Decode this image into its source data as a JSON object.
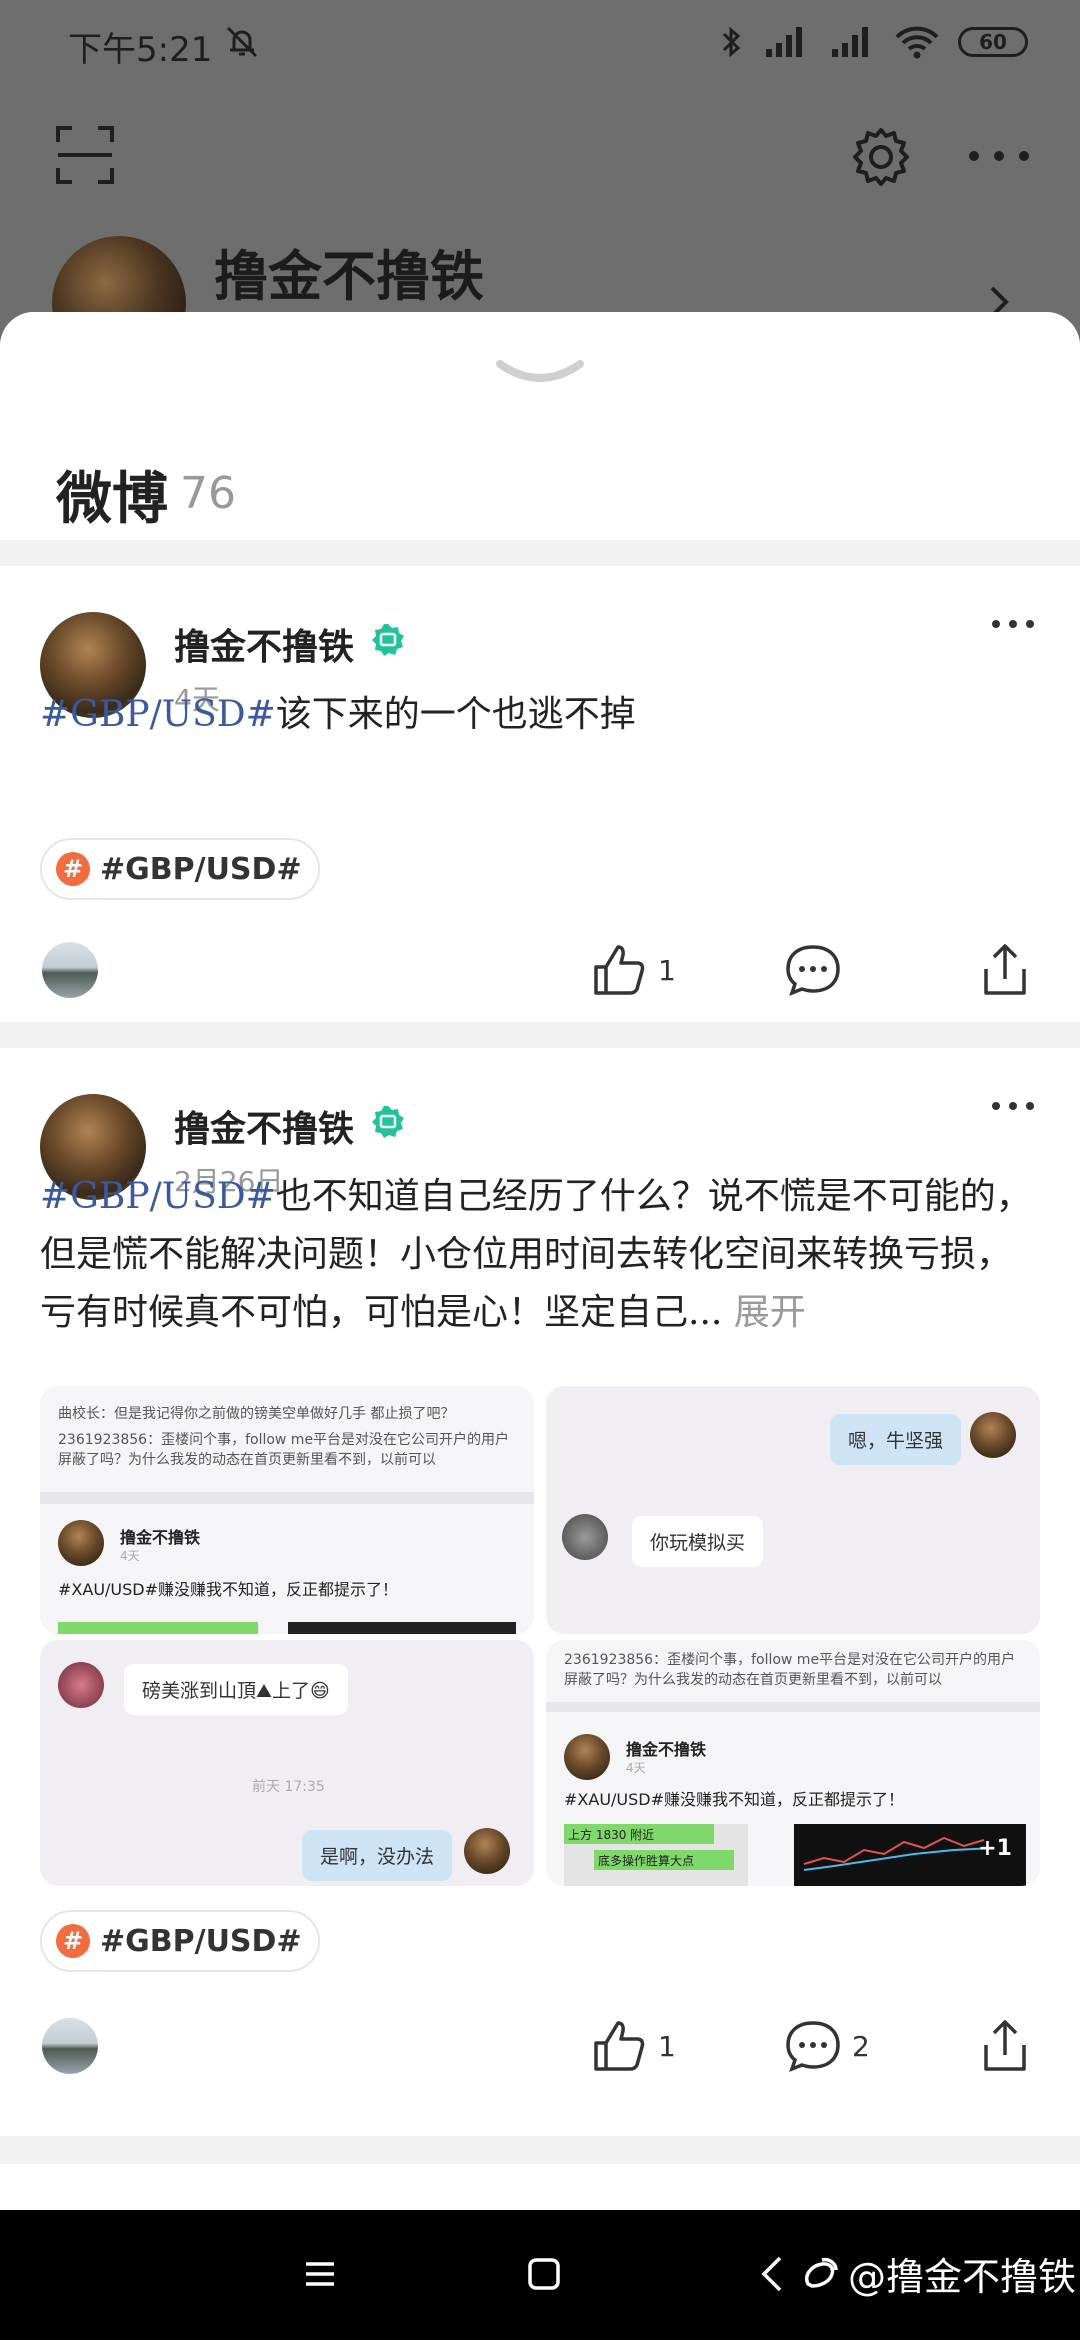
{
  "status_bar": {
    "time": "下午5:21",
    "battery": "60"
  },
  "profile": {
    "name": "撸金不撸铁"
  },
  "sheet": {
    "title": "微博",
    "count": "76"
  },
  "posts": [
    {
      "author": "撸金不撸铁",
      "date": "4天",
      "tag": "#GBP/USD#",
      "text": "该下来的一个也逃不掉",
      "topic": "#GBP/USD#",
      "likes": "1",
      "comments": ""
    },
    {
      "author": "撸金不撸铁",
      "date": "2月26日",
      "tag": "#GBP/USD#",
      "text": "也不知道自己经历了什么？说不慌是不可能的，但是慌不能解决问题！小仓位用时间去转化空间来转换亏损，亏有时候真不可怕，可怕是心！坚定自己...",
      "expand": "展开",
      "topic": "#GBP/USD#",
      "likes": "1",
      "comments": "2"
    }
  ],
  "images": {
    "img1": {
      "line1": "曲校长：但是我记得你之前做的镑美空单做好几手  都止损了吧？",
      "line2": "2361923856：歪楼问个事，follow me平台是对没在它公司开户的用户",
      "line3": "屏蔽了吗？为什么我发的动态在首页更新里看不到，以前可以",
      "author": "撸金不撸铁",
      "date": "4天",
      "text": "#XAU/USD#赚没赚我不知道，反正都提示了！"
    },
    "img2": {
      "bubble1": "嗯，牛坚强",
      "bubble2": "你玩模拟买"
    },
    "img3": {
      "bubble1": "磅美涨到山頂⛰上了😄",
      "time": "前天 17:35",
      "bubble2": "是啊，没办法"
    },
    "img4": {
      "line1": "2361923856：歪楼问个事，follow me平台是对没在它公司开户的用户",
      "line2": "屏蔽了吗？为什么我发的动态在首页更新里看不到，以前可以",
      "author": "撸金不撸铁",
      "date": "4天",
      "text": "#XAU/USD#赚没赚我不知道，反正都提示了！",
      "label1": "上方 1830 附近",
      "label2": "底多操作胜算大点",
      "more": "+1"
    }
  },
  "watermark": "@撸金不撸铁",
  "colors": {
    "link": "#3b5a9e",
    "topic_hash": "#f26d3d",
    "verified": "#22c39a"
  }
}
